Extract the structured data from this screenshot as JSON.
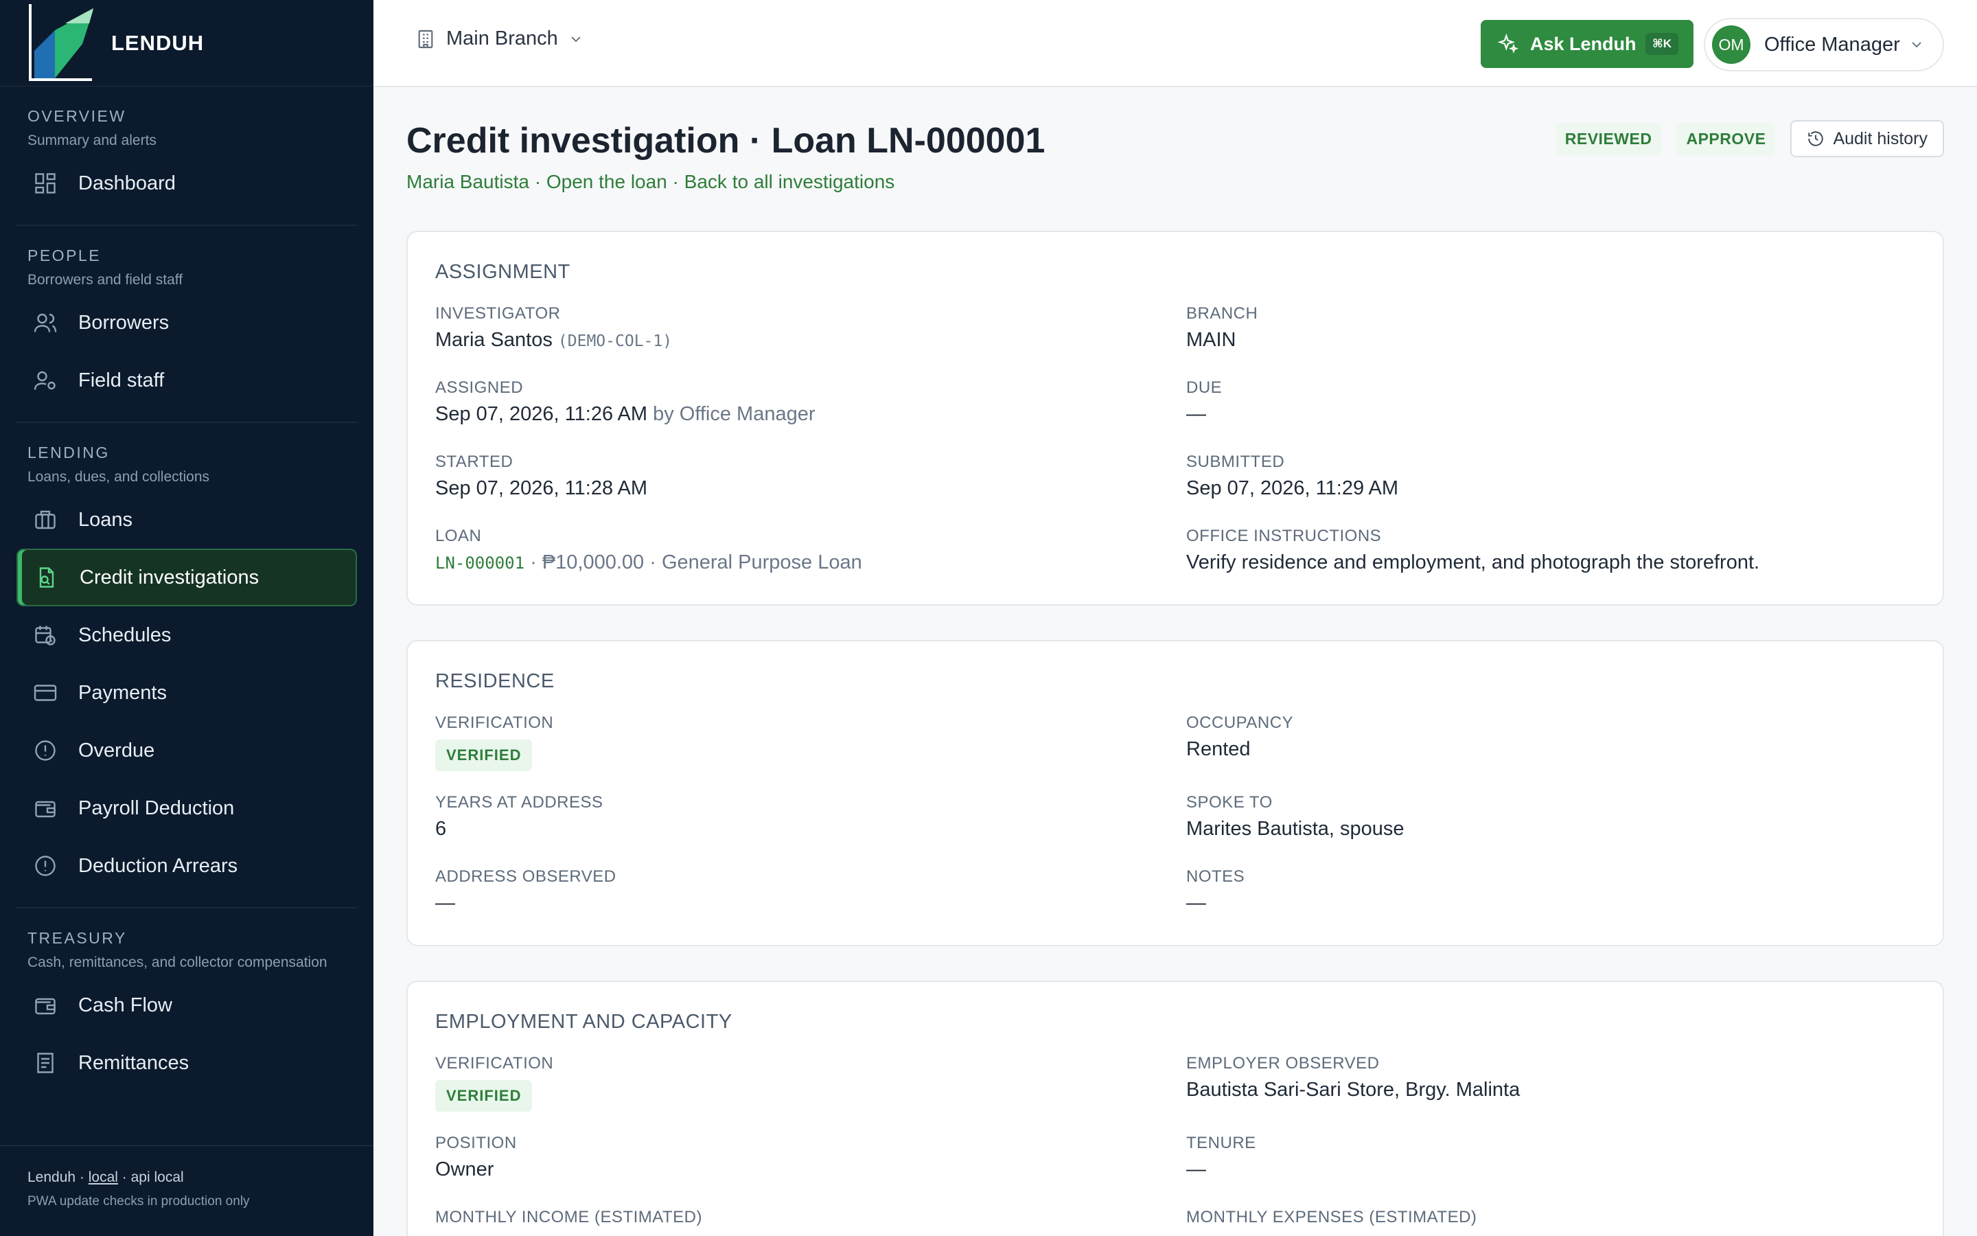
{
  "app": {
    "name": "LENDUH"
  },
  "sidebar": {
    "sections": [
      {
        "title": "OVERVIEW",
        "subtitle": "Summary and alerts",
        "items": [
          {
            "label": "Dashboard",
            "icon": "dashboard-icon"
          }
        ]
      },
      {
        "title": "PEOPLE",
        "subtitle": "Borrowers and field staff",
        "items": [
          {
            "label": "Borrowers",
            "icon": "users-icon"
          },
          {
            "label": "Field staff",
            "icon": "user-gear-icon"
          }
        ]
      },
      {
        "title": "LENDING",
        "subtitle": "Loans, dues, and collections",
        "items": [
          {
            "label": "Loans",
            "icon": "briefcase-icon"
          },
          {
            "label": "Credit investigations",
            "icon": "file-search-icon",
            "active": true
          },
          {
            "label": "Schedules",
            "icon": "calendar-clock-icon"
          },
          {
            "label": "Payments",
            "icon": "credit-card-icon"
          },
          {
            "label": "Overdue",
            "icon": "alert-circle-icon"
          },
          {
            "label": "Payroll Deduction",
            "icon": "wallet-icon"
          },
          {
            "label": "Deduction Arrears",
            "icon": "alert-circle-icon"
          }
        ]
      },
      {
        "title": "TREASURY",
        "subtitle": "Cash, remittances, and collector compensation",
        "items": [
          {
            "label": "Cash Flow",
            "icon": "wallet-icon"
          },
          {
            "label": "Remittances",
            "icon": "receipt-icon"
          }
        ]
      }
    ],
    "footer": {
      "line1_a": "Lenduh · ",
      "line1_b": "local",
      "line1_c": " · api local",
      "line2": "PWA update checks in production only"
    }
  },
  "topbar": {
    "branch": "Main Branch",
    "ask_label": "Ask Lenduh",
    "ask_shortcut": "⌘K",
    "user_initials": "OM",
    "user_label": "Office Manager"
  },
  "page": {
    "title": "Credit investigation · Loan LN-000001",
    "link_borrower": "Maria Bautista",
    "sep": " · ",
    "link_open": "Open the loan",
    "link_back": "Back to all investigations",
    "status": "REVIEWED",
    "recommendation": "APPROVE",
    "audit_label": "Audit history"
  },
  "assignment": {
    "title": "ASSIGNMENT",
    "investigator_label": "INVESTIGATOR",
    "investigator": "Maria Santos",
    "investigator_code": "(DEMO-COL-1)",
    "branch_label": "BRANCH",
    "branch": "MAIN",
    "assigned_label": "ASSIGNED",
    "assigned": "Sep 07, 2026, 11:26 AM",
    "assigned_by": " by Office Manager",
    "due_label": "DUE",
    "due": "—",
    "started_label": "STARTED",
    "started": "Sep 07, 2026, 11:28 AM",
    "submitted_label": "SUBMITTED",
    "submitted": "Sep 07, 2026, 11:29 AM",
    "loan_label": "LOAN",
    "loan_number": "LN-000001",
    "loan_rest": " · ₱10,000.00 · General Purpose Loan",
    "instructions_label": "OFFICE INSTRUCTIONS",
    "instructions": "Verify residence and employment, and photograph the storefront."
  },
  "residence": {
    "title": "RESIDENCE",
    "verification_label": "VERIFICATION",
    "verification": "VERIFIED",
    "occupancy_label": "OCCUPANCY",
    "occupancy": "Rented",
    "years_label": "YEARS AT ADDRESS",
    "years": "6",
    "spoke_label": "SPOKE TO",
    "spoke": "Marites Bautista, spouse",
    "address_label": "ADDRESS OBSERVED",
    "address": "—",
    "notes_label": "NOTES",
    "notes": "—"
  },
  "employment": {
    "title": "EMPLOYMENT AND CAPACITY",
    "verification_label": "VERIFICATION",
    "verification": "VERIFIED",
    "employer_label": "EMPLOYER OBSERVED",
    "employer": "Bautista Sari-Sari Store, Brgy. Malinta",
    "position_label": "POSITION",
    "position": "Owner",
    "tenure_label": "TENURE",
    "tenure": "—",
    "income_label": "MONTHLY INCOME (ESTIMATED)",
    "expenses_label": "MONTHLY EXPENSES (ESTIMATED)"
  }
}
